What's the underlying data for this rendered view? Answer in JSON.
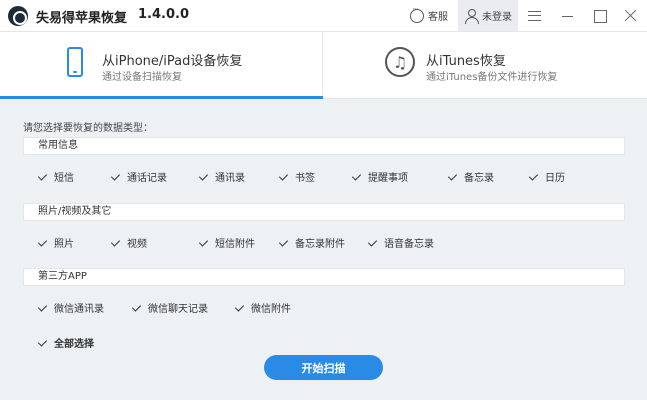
{
  "app": {
    "title": "失易得苹果恢复",
    "version": "1.4.0.0"
  },
  "titlebar": {
    "service_label": "客服",
    "login_label": "未登录"
  },
  "modes": [
    {
      "title": "从iPhone/iPad设备恢复",
      "subtitle": "通过设备扫描恢复",
      "active": true
    },
    {
      "title": "从iTunes恢复",
      "subtitle": "通过iTunes备份文件进行恢复",
      "active": false
    }
  ],
  "prompt": "请您选择要恢复的数据类型：",
  "sections": [
    {
      "title": "常用信息",
      "items": [
        "短信",
        "通话记录",
        "通讯录",
        "书签",
        "提醒事项",
        "备忘录",
        "日历"
      ],
      "checked": [
        true,
        true,
        true,
        true,
        true,
        true,
        true
      ]
    },
    {
      "title": "照片/视频及其它",
      "items": [
        "照片",
        "视频",
        "短信附件",
        "备忘录附件",
        "语音备忘录"
      ],
      "checked": [
        true,
        true,
        true,
        true,
        true
      ]
    },
    {
      "title": "第三方APP",
      "items": [
        "微信通讯录",
        "微信聊天记录",
        "微信附件"
      ],
      "checked": [
        true,
        true,
        true
      ]
    }
  ],
  "select_all": {
    "label": "全部选择",
    "checked": true
  },
  "start_button": "开始扫描",
  "colors": {
    "accent": "#2a8be6",
    "background": "#eef1f4"
  }
}
